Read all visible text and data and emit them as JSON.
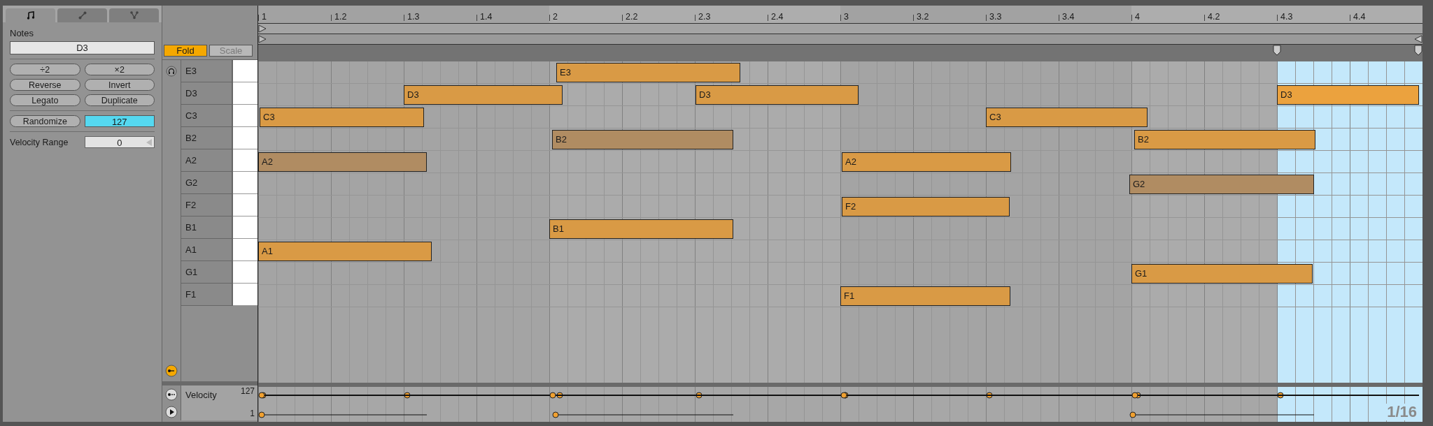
{
  "tabs": [
    {
      "selected": true
    },
    {
      "selected": false
    },
    {
      "selected": false
    }
  ],
  "notes_panel": {
    "title": "Notes",
    "note_field": "D3",
    "buttons": [
      "÷2",
      "×2",
      "Reverse",
      "Invert",
      "Legato",
      "Duplicate"
    ],
    "randomize": {
      "label": "Randomize",
      "value": "127"
    },
    "velocity_range": {
      "label": "Velocity Range",
      "value": "0"
    }
  },
  "toolbar": [
    {
      "label": "Fold",
      "on": true
    },
    {
      "label": "Scale",
      "on": false
    }
  ],
  "ruler": [
    "1",
    "1.2",
    "1.3",
    "1.4",
    "2",
    "2.2",
    "2.3",
    "2.4",
    "3",
    "3.2",
    "3.3",
    "3.4",
    "4",
    "4.2",
    "4.3",
    "4.4"
  ],
  "keys": [
    "E3",
    "D3",
    "C3",
    "B2",
    "A2",
    "G2",
    "F2",
    "B1",
    "A1",
    "G1",
    "F1"
  ],
  "notes": [
    {
      "label": "E3",
      "color": "#d99a45"
    },
    {
      "label": "D3",
      "color": "#d99a45"
    },
    {
      "label": "D3",
      "color": "#d99a45"
    },
    {
      "label": "D3",
      "color": "#eba23e"
    },
    {
      "label": "C3",
      "color": "#d99a45"
    },
    {
      "label": "C3",
      "color": "#d99a45"
    },
    {
      "label": "B2",
      "color": "#b08c62"
    },
    {
      "label": "B2",
      "color": "#d99a45"
    },
    {
      "label": "A2",
      "color": "#b08c62"
    },
    {
      "label": "A2",
      "color": "#d99a45"
    },
    {
      "label": "G2",
      "color": "#b08c62"
    },
    {
      "label": "F2",
      "color": "#d99a45"
    },
    {
      "label": "B1",
      "color": "#d99a45"
    },
    {
      "label": "A1",
      "color": "#d99a45"
    },
    {
      "label": "G1",
      "color": "#d99a45"
    },
    {
      "label": "F1",
      "color": "#d99a45"
    }
  ],
  "velocity_lane": {
    "label": "Velocity",
    "max": "127",
    "min": "1"
  },
  "grid_label": "1/16"
}
